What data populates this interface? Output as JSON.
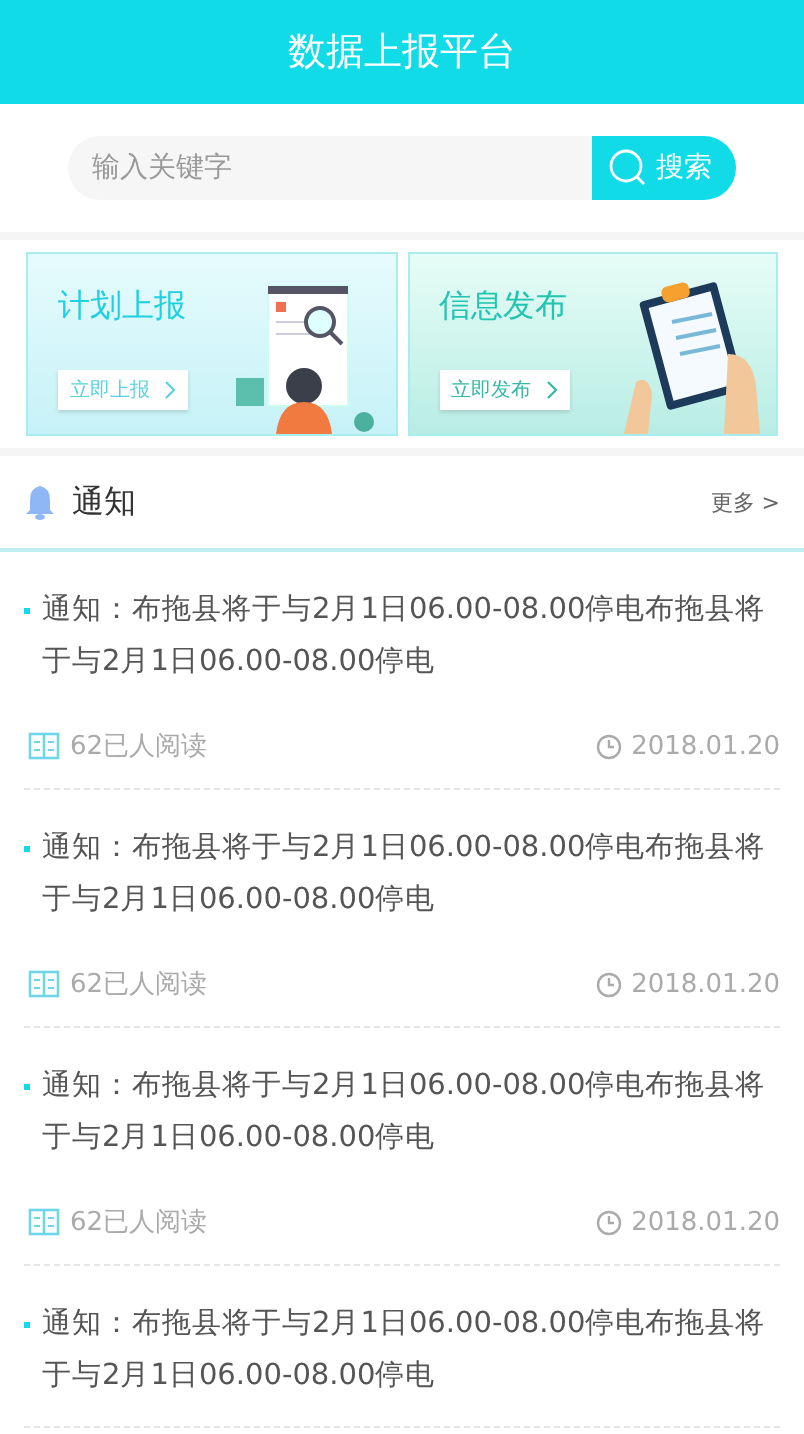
{
  "header": {
    "title": "数据上报平台"
  },
  "search": {
    "placeholder": "输入关键字",
    "button": "搜索"
  },
  "cards": [
    {
      "kind": "report",
      "title": "计划上报",
      "action": "立即上报"
    },
    {
      "kind": "publish",
      "title": "信息发布",
      "action": "立即发布"
    }
  ],
  "notices": {
    "title": "通知",
    "more": "更多 >",
    "items": [
      {
        "title": "通知：布拖县将于与2月1日06.00-08.00停电布拖县将于与2月1日06.00-08.00停电",
        "reads": "62已人阅读",
        "date": "2018.01.20"
      },
      {
        "title": "通知：布拖县将于与2月1日06.00-08.00停电布拖县将于与2月1日06.00-08.00停电",
        "reads": "62已人阅读",
        "date": "2018.01.20"
      },
      {
        "title": "通知：布拖县将于与2月1日06.00-08.00停电布拖县将于与2月1日06.00-08.00停电",
        "reads": "62已人阅读",
        "date": "2018.01.20"
      },
      {
        "title": "通知：布拖县将于与2月1日06.00-08.00停电布拖县将于与2月1日06.00-08.00停电"
      }
    ]
  }
}
